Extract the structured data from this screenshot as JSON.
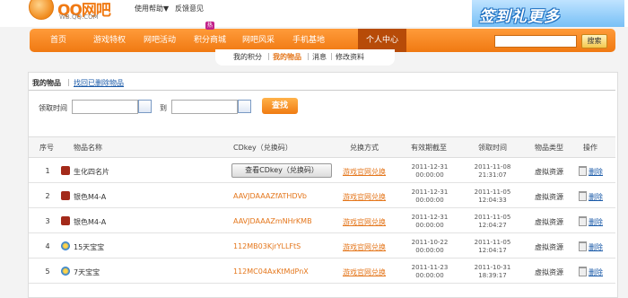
{
  "header": {
    "logo_text": "QQ网吧",
    "logo_sub": "WB.QQ.COM",
    "help": "使用帮助▼",
    "feedback": "反馈意见",
    "banner_text": "签到礼更多"
  },
  "nav": {
    "items": [
      "首页",
      "游戏特权",
      "网吧活动",
      "积分商城",
      "网吧风采",
      "手机基地",
      "个人中心"
    ],
    "hot_badge": "热",
    "search_button": "搜索",
    "active_index": 6
  },
  "subnav": {
    "items": [
      "我的积分",
      "我的物品",
      "消息",
      "修改资料"
    ],
    "active_index": 1
  },
  "panel": {
    "tab_mine": "我的物品",
    "tab_recover": "找回已删除物品",
    "label_time": "领取时间",
    "label_to": "到",
    "find_button": "查找"
  },
  "table": {
    "headers": [
      "序号",
      "物品名称",
      "CDkey（兑换码）",
      "兑换方式",
      "有效期截至",
      "领取时间",
      "物品类型",
      "操作"
    ],
    "view_cdkey_label": "查看CDkey（兑换码）",
    "rows": [
      {
        "no": "1",
        "name": "生化四名片",
        "cdkey": "",
        "exchange": "游戏官网兑换",
        "expire_date": "2011-12-31",
        "expire_time": "00:00:00",
        "recv_date": "2011-11-08",
        "recv_time": "21:31:07",
        "type": "虚拟资源",
        "action": "删除",
        "icon": "game-icon"
      },
      {
        "no": "2",
        "name": "银色M4-A",
        "cdkey": "AAVJDAAAZfATHDVb",
        "exchange": "游戏官网兑换",
        "expire_date": "2011-12-31",
        "expire_time": "00:00:00",
        "recv_date": "2011-11-05",
        "recv_time": "12:04:33",
        "type": "虚拟资源",
        "action": "删除",
        "icon": "game-icon"
      },
      {
        "no": "3",
        "name": "银色M4-A",
        "cdkey": "AAVJDAAAZmNHrKMB",
        "exchange": "游戏官网兑换",
        "expire_date": "2011-12-31",
        "expire_time": "00:00:00",
        "recv_date": "2011-11-05",
        "recv_time": "12:04:27",
        "type": "虚拟资源",
        "action": "删除",
        "icon": "game-icon"
      },
      {
        "no": "4",
        "name": "15天宝宝",
        "cdkey": "112MB03KjrYLLFtS",
        "exchange": "游戏官网兑换",
        "expire_date": "2011-10-22",
        "expire_time": "00:00:00",
        "recv_date": "2011-11-05",
        "recv_time": "12:04:17",
        "type": "虚拟资源",
        "action": "删除",
        "icon": "qq-pet-icon"
      },
      {
        "no": "5",
        "name": "7天宝宝",
        "cdkey": "112MC04AxKtMdPnX",
        "exchange": "游戏官网兑换",
        "expire_date": "2011-11-23",
        "expire_time": "00:00:00",
        "recv_date": "2011-10-31",
        "recv_time": "18:39:17",
        "type": "虚拟资源",
        "action": "删除",
        "icon": "qq-pet-icon"
      }
    ]
  },
  "colors": {
    "nav_orange": "#f07912",
    "nav_active": "#b74b08",
    "cdkey_orange": "#e4761b",
    "link_blue": "#1a5aa8"
  }
}
